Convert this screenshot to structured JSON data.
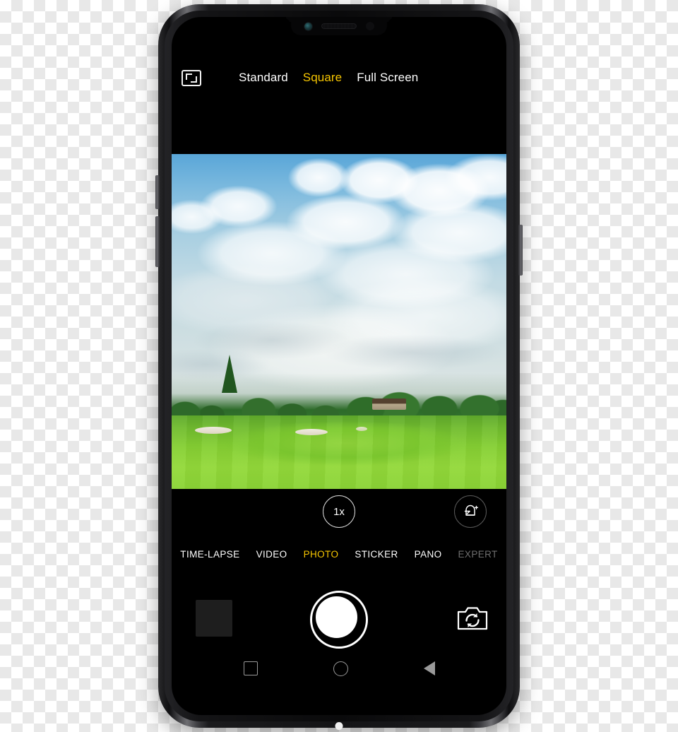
{
  "device": {
    "name": "smartphone-mockup",
    "notch": {
      "front_camera": "front-camera-icon",
      "earpiece": "earpiece-speaker-icon",
      "proximity_sensor": "proximity-sensor-icon"
    },
    "hardware_buttons": {
      "volume_up": "volume-up-button",
      "volume_down": "volume-down-button",
      "power": "power-button"
    }
  },
  "colors": {
    "accent_yellow": "#f7c600",
    "text_white": "#ffffff",
    "text_dim": "#6e6e6e",
    "screen_black": "#000000",
    "thumbnail": "#1e1e1e"
  },
  "app": {
    "name": "Camera",
    "topbar": {
      "aspect_icon": "aspect-ratio-frame-icon",
      "ratios": [
        {
          "label": "Standard",
          "selected": false
        },
        {
          "label": "Square",
          "selected": true
        },
        {
          "label": "Full Screen",
          "selected": false
        }
      ]
    },
    "viewfinder": {
      "mode": "Square",
      "scene_description": "Golf course fairway with tree line and clubhouse under a blue sky filled with white cumulus clouds"
    },
    "controls": {
      "zoom_label": "1x",
      "beauty_icon": "beauty-face-sparkle-icon"
    },
    "modes": [
      {
        "label": "TIME-LAPSE",
        "selected": false,
        "dim": false
      },
      {
        "label": "VIDEO",
        "selected": false,
        "dim": false
      },
      {
        "label": "PHOTO",
        "selected": true,
        "dim": false
      },
      {
        "label": "STICKER",
        "selected": false,
        "dim": false
      },
      {
        "label": "PANO",
        "selected": false,
        "dim": false
      },
      {
        "label": "EXPERT",
        "selected": false,
        "dim": true
      }
    ],
    "shutter_row": {
      "gallery_thumbnail": "gallery-thumbnail",
      "shutter": "shutter-button",
      "flip_camera": "flip-camera-icon"
    },
    "navbar": [
      {
        "icon": "recents-square-icon"
      },
      {
        "icon": "home-circle-icon"
      },
      {
        "icon": "back-triangle-icon"
      }
    ]
  }
}
